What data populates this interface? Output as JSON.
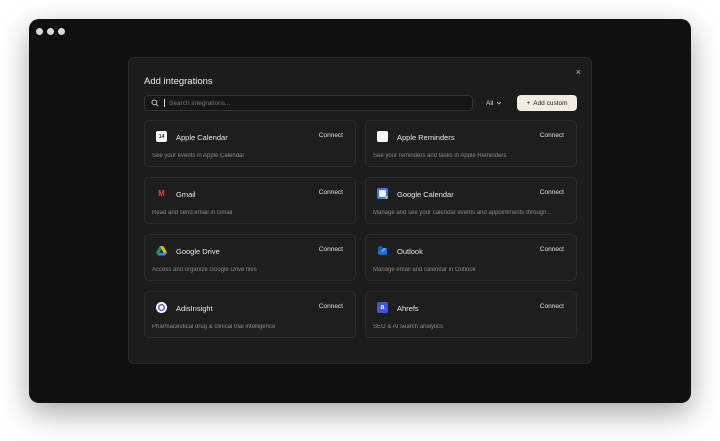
{
  "modal": {
    "title": "Add integrations",
    "close_symbol": "×"
  },
  "search": {
    "placeholder": "Search integrations..."
  },
  "filter": {
    "selected": "All"
  },
  "add_custom": {
    "label": "Add custom",
    "plus": "+"
  },
  "integrations": [
    {
      "name": "Apple Calendar",
      "description": "See your events in Apple Calendar",
      "action": "Connect",
      "icon": "apple-calendar-icon",
      "icon_text": "14"
    },
    {
      "name": "Apple Reminders",
      "description": "See your reminders and tasks in Apple Reminders",
      "action": "Connect",
      "icon": "apple-reminders-icon"
    },
    {
      "name": "Gmail",
      "description": "Read and send email in Gmail",
      "action": "Connect",
      "icon": "gmail-icon",
      "icon_text": "M"
    },
    {
      "name": "Google Calendar",
      "description": "Manage and see your calendar events and appointments through...",
      "action": "Connect",
      "icon": "google-calendar-icon"
    },
    {
      "name": "Google Drive",
      "description": "Access and organize Google Drive files",
      "action": "Connect",
      "icon": "google-drive-icon"
    },
    {
      "name": "Outlook",
      "description": "Manage email and calendar in Outlook",
      "action": "Connect",
      "icon": "outlook-icon"
    },
    {
      "name": "AdisInsight",
      "description": "Pharmaceutical drug & clinical trial intelligence",
      "action": "Connect",
      "icon": "adisinsight-icon"
    },
    {
      "name": "Ahrefs",
      "description": "SEO & AI search analytics",
      "action": "Connect",
      "icon": "ahrefs-icon",
      "icon_text": "a"
    }
  ],
  "colors": {
    "window_bg": "#101010",
    "modal_bg": "#1c1c1c",
    "card_bg": "#1e1e1e",
    "button_bg": "#f1ecdf"
  }
}
